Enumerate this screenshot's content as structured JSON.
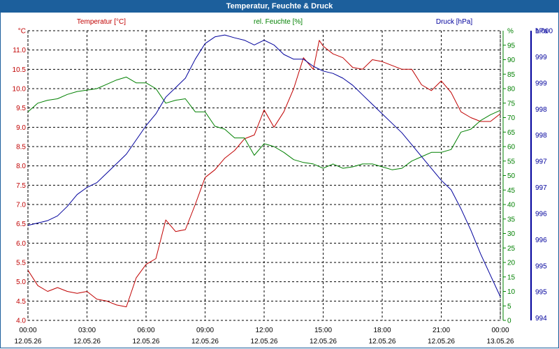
{
  "window": {
    "title": "Temperatur, Feuchte & Druck"
  },
  "colors": {
    "temperature": "#c00000",
    "humidity": "#008000",
    "pressure": "#00009c",
    "titlebar": "#1c5f9c",
    "grid": "#000000"
  },
  "chart_data": {
    "type": "line",
    "title": "Temperatur, Feuchte & Druck",
    "grid": true,
    "x_ticks": [
      {
        "time": "00:00",
        "date": "12.05.26"
      },
      {
        "time": "03:00",
        "date": "12.05.26"
      },
      {
        "time": "06:00",
        "date": "12.05.26"
      },
      {
        "time": "09:00",
        "date": "12.05.26"
      },
      {
        "time": "12:00",
        "date": "12.05.26"
      },
      {
        "time": "15:00",
        "date": "12.05.26"
      },
      {
        "time": "18:00",
        "date": "12.05.26"
      },
      {
        "time": "21:00",
        "date": "12.05.26"
      },
      {
        "time": "00:00",
        "date": "13.05.26"
      }
    ],
    "x_unit_label": "hours",
    "axes": {
      "left": {
        "label": "Temperatur [°C]",
        "unit": "°C",
        "ylim": [
          4.0,
          11.5
        ],
        "ticks": [
          "4.0",
          "4.5",
          "5.0",
          "5.5",
          "6.0",
          "6.5",
          "7.0",
          "7.5",
          "8.0",
          "8.5",
          "9.0",
          "9.5",
          "10.0",
          "10.5",
          "11.0"
        ]
      },
      "mid": {
        "label": "rel. Feuchte [%]",
        "unit": "%",
        "ylim": [
          0,
          100
        ],
        "ticks": [
          "0",
          "5",
          "10",
          "15",
          "20",
          "25",
          "30",
          "35",
          "40",
          "45",
          "50",
          "55",
          "60",
          "65",
          "70",
          "75",
          "80",
          "85",
          "90",
          "95"
        ]
      },
      "right": {
        "label": "Druck [hPa]",
        "unit": "hPa",
        "ticks": [
          "994",
          "995",
          "995",
          "996",
          "996",
          "997",
          "997",
          "998",
          "998",
          "999",
          "999",
          "1.000"
        ]
      }
    },
    "series": [
      {
        "name": "Temperatur [°C]",
        "axis": "left",
        "x": [
          0,
          0.5,
          1,
          1.5,
          2,
          2.5,
          3,
          3.5,
          4,
          4.5,
          5,
          5.5,
          6,
          6.5,
          7,
          7.5,
          8,
          8.5,
          9,
          9.5,
          10,
          10.5,
          11,
          11.5,
          12,
          12.5,
          13,
          13.5,
          14,
          14.5,
          14.8,
          15,
          15.5,
          16,
          16.5,
          17,
          17.5,
          18,
          18.5,
          19,
          19.5,
          20,
          20.5,
          21,
          21.5,
          22,
          22.5,
          23,
          23.5,
          24
        ],
        "values": [
          5.3,
          4.9,
          4.75,
          4.85,
          4.75,
          4.7,
          4.75,
          4.55,
          4.5,
          4.4,
          4.35,
          5.1,
          5.45,
          5.6,
          6.6,
          6.3,
          6.35,
          7.0,
          7.7,
          7.9,
          8.2,
          8.4,
          8.7,
          8.8,
          9.45,
          9.0,
          9.4,
          10.0,
          10.8,
          10.5,
          11.25,
          11.1,
          10.9,
          10.8,
          10.55,
          10.5,
          10.75,
          10.7,
          10.6,
          10.5,
          10.5,
          10.1,
          9.95,
          10.2,
          9.9,
          9.4,
          9.25,
          9.15,
          9.15,
          9.35
        ]
      },
      {
        "name": "rel. Feuchte [%]",
        "axis": "mid",
        "x": [
          0,
          0.5,
          1,
          1.5,
          2,
          2.5,
          3,
          3.5,
          4,
          4.5,
          5,
          5.5,
          6,
          6.5,
          7,
          7.5,
          8,
          8.5,
          9,
          9.5,
          10,
          10.5,
          11,
          11.5,
          12,
          12.5,
          13,
          13.5,
          14,
          14.5,
          15,
          15.5,
          16,
          16.5,
          17,
          17.5,
          18,
          18.5,
          19,
          19.5,
          20,
          20.5,
          21,
          21.5,
          22,
          22.5,
          23,
          23.5,
          24
        ],
        "values": [
          72,
          75,
          76,
          76.5,
          78,
          79,
          79.5,
          80,
          81.5,
          83,
          84,
          82,
          82,
          80,
          75,
          76,
          76.5,
          72,
          72,
          67,
          66,
          63,
          63,
          57,
          61,
          60,
          58,
          55.5,
          54.5,
          54,
          52.5,
          54,
          52.5,
          53,
          54,
          54,
          53,
          52,
          52.5,
          55,
          56.5,
          58,
          58,
          59,
          65,
          66,
          69,
          71,
          72.5
        ]
      },
      {
        "name": "Druck [hPa]",
        "axis": "right",
        "x": [
          0,
          0.5,
          1,
          1.5,
          2,
          2.5,
          3,
          3.5,
          4,
          4.5,
          5,
          5.5,
          6,
          6.5,
          7,
          7.5,
          8,
          8.5,
          9,
          9.5,
          10,
          10.5,
          11,
          11.5,
          12,
          12.5,
          13,
          13.5,
          14,
          14.5,
          15,
          15.5,
          16,
          16.5,
          17,
          17.5,
          18,
          18.5,
          19,
          19.5,
          20,
          20.5,
          21,
          21.5,
          22,
          22.5,
          23,
          23.5,
          24
        ],
        "values": [
          995.95,
          996.0,
          996.05,
          996.15,
          996.35,
          996.6,
          996.75,
          996.85,
          997.05,
          997.25,
          997.45,
          997.75,
          998.05,
          998.3,
          998.65,
          998.85,
          999.05,
          999.45,
          999.78,
          999.92,
          999.96,
          999.9,
          999.85,
          999.75,
          999.85,
          999.75,
          999.55,
          999.45,
          999.45,
          999.3,
          999.2,
          999.15,
          999.05,
          998.9,
          998.7,
          998.5,
          998.3,
          998.1,
          997.9,
          997.65,
          997.4,
          997.15,
          996.9,
          996.7,
          996.3,
          995.85,
          995.35,
          994.9,
          994.45
        ]
      }
    ]
  }
}
